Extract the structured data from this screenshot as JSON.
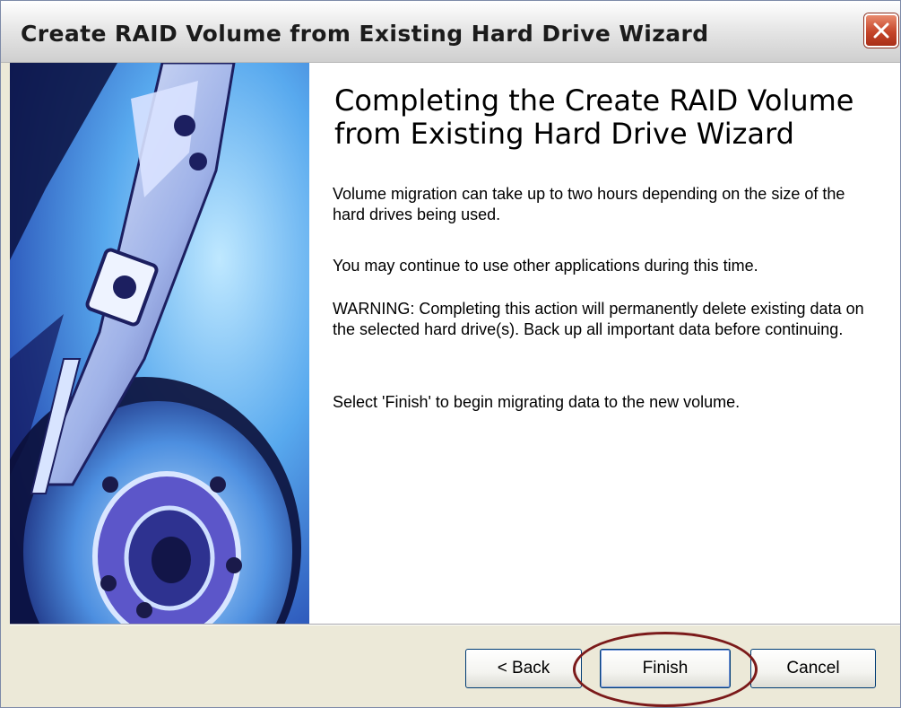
{
  "window": {
    "title": "Create RAID Volume from Existing Hard Drive Wizard"
  },
  "content": {
    "heading": "Completing the Create RAID Volume from Existing Hard Drive Wizard",
    "paragraphs": [
      "Volume migration can take up to two hours depending on the size of the hard drives being used.",
      "You may continue to use other applications during this time.",
      "WARNING: Completing this action will permanently delete existing data on the selected hard drive(s). Back up all important data before continuing.",
      "Select 'Finish' to begin migrating data to the new volume."
    ]
  },
  "buttons": {
    "back": "< Back",
    "finish": "Finish",
    "cancel": "Cancel"
  },
  "icons": {
    "close": "close-icon",
    "side_image": "hard-drive-image"
  },
  "colors": {
    "highlight_oval": "#7b1a1a",
    "close_button": "#c5452a"
  }
}
